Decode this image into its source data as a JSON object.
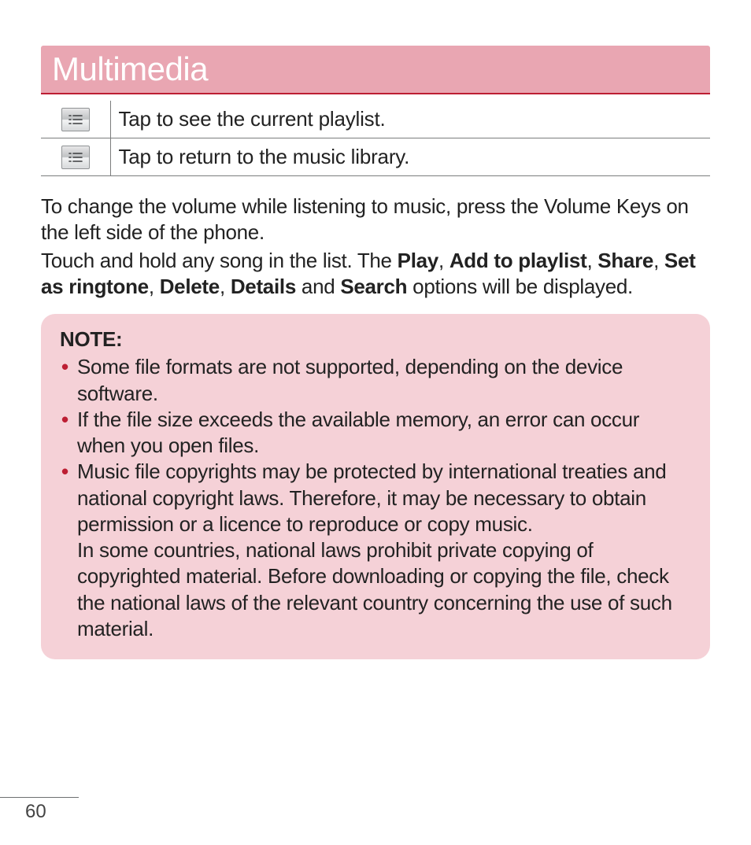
{
  "header": {
    "title": "Multimedia"
  },
  "icon_table": {
    "rows": [
      {
        "icon": "playlist-icon",
        "desc": "Tap to see the current playlist."
      },
      {
        "icon": "library-icon",
        "desc": "Tap to return to the music library."
      }
    ]
  },
  "body": {
    "p1": "To change the volume while listening to music, press the Volume Keys on the left side of the phone.",
    "p2_pre": "Touch and hold any song in the list. The ",
    "opts": {
      "play": "Play",
      "add": "Add to playlist",
      "share": "Share",
      "set_as_pre": "Set as ",
      "ringtone": "ringtone",
      "delete": "Delete",
      "details": "Details",
      "search": "Search"
    },
    "p2_mid_and": " and ",
    "p2_post": " options will be displayed."
  },
  "note": {
    "title": "NOTE:",
    "items": [
      "Some file formats are not supported, depending on the device software.",
      "If the file size exceeds the available memory, an error can occur when you open files.",
      "Music file copyrights may be protected by international treaties and national copyright laws. Therefore, it may be necessary to obtain permission or a licence to reproduce or copy music."
    ],
    "item3_extra": "In some countries, national laws prohibit private copying of copyrighted material. Before downloading or copying the file, check the national laws of the relevant country concerning the use of such material."
  },
  "page_number": "60",
  "sep": {
    "comma": ", ",
    "comma2": ", "
  }
}
